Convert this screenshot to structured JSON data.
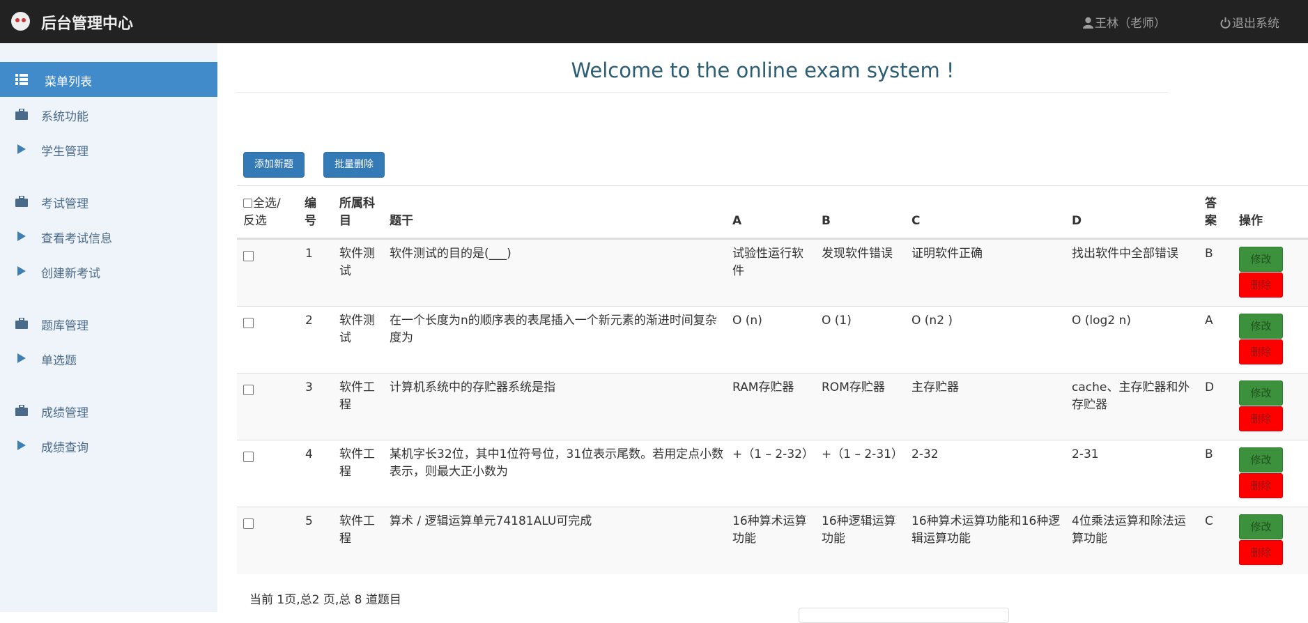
{
  "header": {
    "brand": "后台管理中心",
    "user": "王林（老师）",
    "logout": "退出系统"
  },
  "sidebar": {
    "items": [
      {
        "label": "菜单列表",
        "icon": "list-icon",
        "active": true
      },
      {
        "label": "系统功能",
        "icon": "briefcase-icon"
      },
      {
        "label": "学生管理",
        "icon": "play-icon"
      },
      {
        "label": "考试管理",
        "icon": "briefcase-icon"
      },
      {
        "label": "查看考试信息",
        "icon": "play-icon"
      },
      {
        "label": "创建新考试",
        "icon": "play-icon"
      },
      {
        "label": "题库管理",
        "icon": "briefcase-icon"
      },
      {
        "label": "单选题",
        "icon": "play-icon"
      },
      {
        "label": "成绩管理",
        "icon": "briefcase-icon"
      },
      {
        "label": "成绩查询",
        "icon": "play-icon"
      }
    ]
  },
  "main": {
    "welcome": "Welcome to the online exam system !",
    "buttons": {
      "add": "添加新题",
      "batch_delete": "批量删除"
    },
    "table": {
      "headers": {
        "select_line1": "全选/",
        "select_line2": "反选",
        "id_line1": "编",
        "id_line2": "号",
        "subject_line1": "所属科",
        "subject_line2": "目",
        "question": "题干",
        "a": "A",
        "b": "B",
        "c": "C",
        "d": "D",
        "answer_line1": "答",
        "answer_line2": "案",
        "ops": "操作"
      },
      "edit_label": "修改",
      "delete_label": "删除",
      "rows": [
        {
          "id": "1",
          "subject": "软件测试",
          "question": "软件测试的目的是(___)",
          "a": "试验性运行软件",
          "b": "发现软件错误",
          "c": "证明软件正确",
          "d": "找出软件中全部错误",
          "answer": "B"
        },
        {
          "id": "2",
          "subject": "软件测试",
          "question": "在一个长度为n的顺序表的表尾插入一个新元素的渐进时间复杂度为",
          "a": "O (n)",
          "b": "O (1)",
          "c": "O (n2 )",
          "d": "O (log2 n)",
          "answer": "A"
        },
        {
          "id": "3",
          "subject": "软件工程",
          "question": "计算机系统中的存贮器系统是指",
          "a": "RAM存贮器",
          "b": "ROM存贮器",
          "c": "主存贮器",
          "d": "cache、主存贮器和外存贮器",
          "answer": "D"
        },
        {
          "id": "4",
          "subject": "软件工程",
          "question": "某机字长32位，其中1位符号位，31位表示尾数。若用定点小数表示，则最大正小数为",
          "a": "+（1 – 2-32）",
          "b": "+（1 – 2-31）",
          "c": "2-32",
          "d": "2-31",
          "answer": "B"
        },
        {
          "id": "5",
          "subject": "软件工程",
          "question": "算术 / 逻辑运算单元74181ALU可完成",
          "a": "16种算术运算功能",
          "b": "16种逻辑运算功能",
          "c": "16种算术运算功能和16种逻辑运算功能",
          "d": "4位乘法运算和除法运算功能",
          "answer": "C"
        }
      ]
    },
    "pagination": {
      "info": "当前 1页,总2 页,总 8 道题目"
    }
  }
}
